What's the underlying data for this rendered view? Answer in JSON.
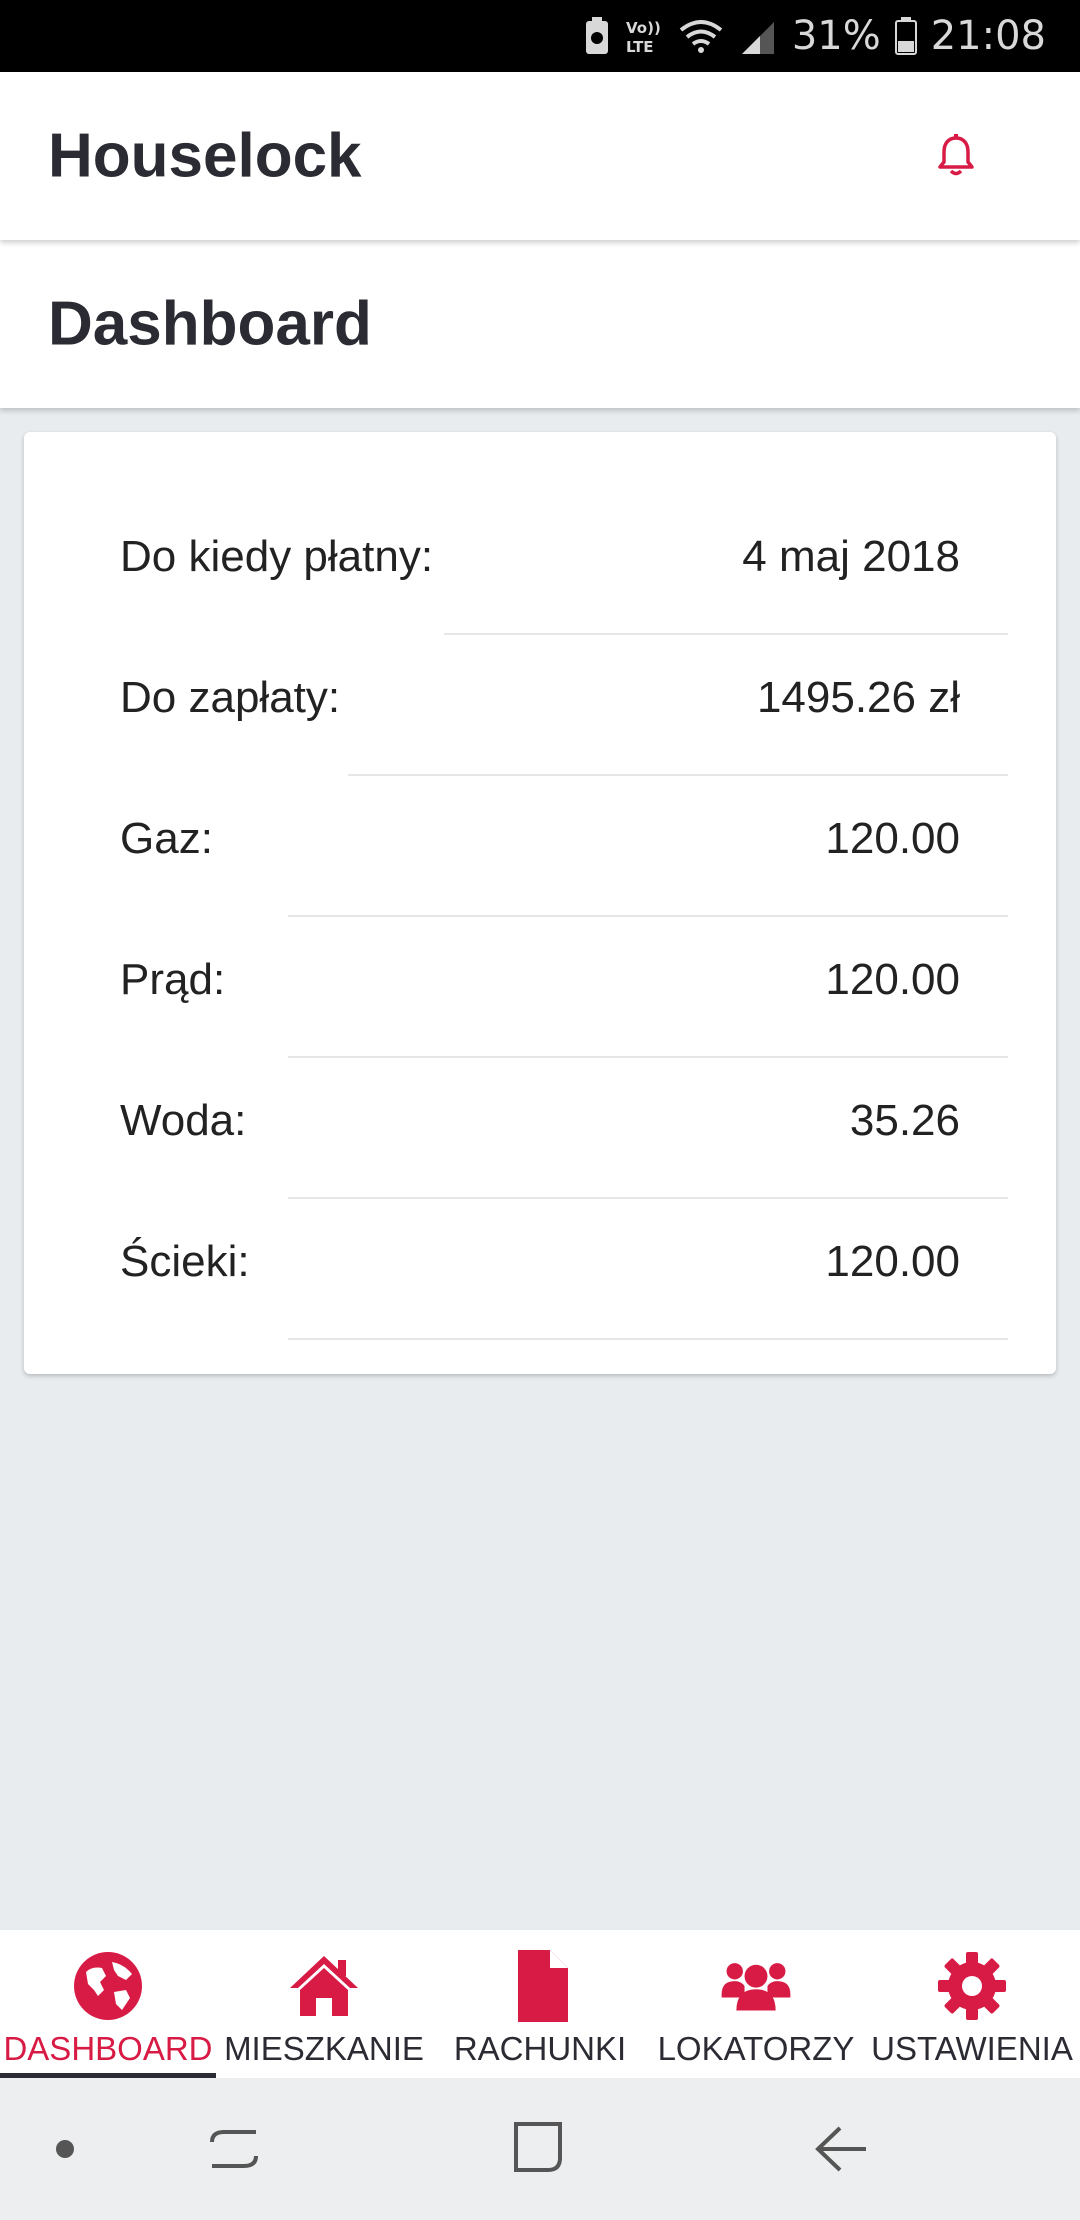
{
  "status_bar": {
    "battery": "31%",
    "time": "21:08",
    "icons": [
      "battery-saver-icon",
      "volte-icon",
      "wifi-icon",
      "signal-icon",
      "battery-icon"
    ]
  },
  "header": {
    "app_title": "Houselock",
    "notification_icon": "bell-icon"
  },
  "page": {
    "title": "Dashboard"
  },
  "summary": {
    "rows": [
      {
        "label": "Do kiedy płatny:",
        "value": "4 maj 2018"
      },
      {
        "label": "Do zapłaty:",
        "value": "1495.26 zł"
      },
      {
        "label": "Gaz:",
        "value": "120.00"
      },
      {
        "label": "Prąd:",
        "value": "120.00"
      },
      {
        "label": "Woda:",
        "value": "35.26"
      },
      {
        "label": "Ścieki:",
        "value": "120.00"
      }
    ]
  },
  "bottom_nav": {
    "items": [
      {
        "label": "DASHBOARD",
        "icon": "globe-icon",
        "active": true
      },
      {
        "label": "MIESZKANIE",
        "icon": "home-icon",
        "active": false
      },
      {
        "label": "RACHUNKI",
        "icon": "file-icon",
        "active": false
      },
      {
        "label": "LOKATORZY",
        "icon": "users-icon",
        "active": false
      },
      {
        "label": "USTAWIENIA",
        "icon": "gear-icon",
        "active": false
      }
    ]
  },
  "system_nav": {
    "icons": [
      "dot-icon",
      "recent-apps-icon",
      "home-square-icon",
      "back-icon"
    ]
  },
  "colors": {
    "accent": "#d81b45",
    "text": "#2b2b33",
    "background": "#e9ecef"
  }
}
